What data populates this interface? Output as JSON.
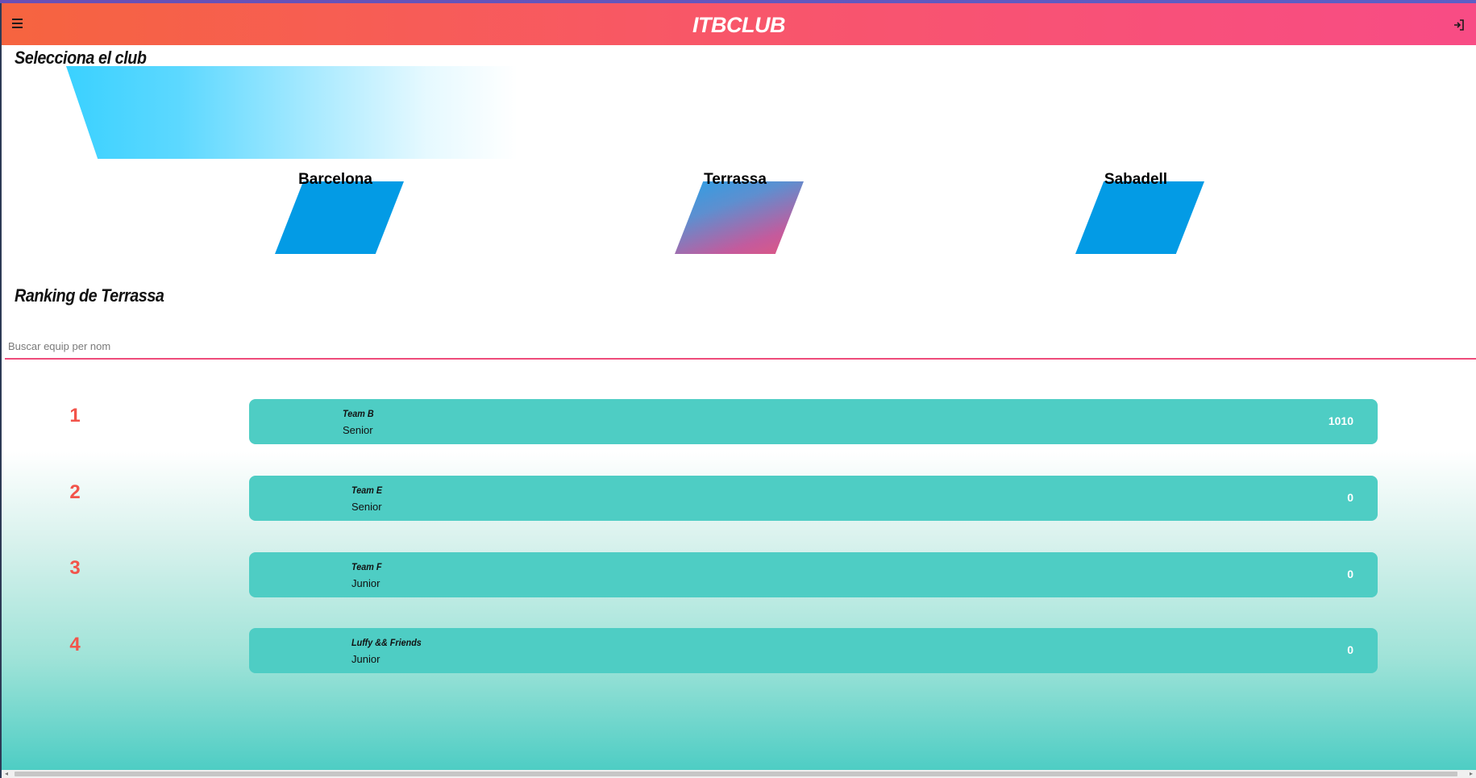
{
  "header": {
    "title": "ITBCLUB",
    "menu_icon": "hamburger-menu-icon",
    "login_icon": "sign-in-icon",
    "gradient_start": "#f6643f",
    "gradient_end": "#f84c85"
  },
  "select_section": {
    "title": "Selecciona el club"
  },
  "clubs": [
    {
      "name": "Barcelona",
      "active": false
    },
    {
      "name": "Terrassa",
      "active": true
    },
    {
      "name": "Sabadell",
      "active": false
    }
  ],
  "ranking": {
    "title": "Ranking de Terrassa",
    "search_placeholder": "Buscar equip per nom",
    "search_value": "",
    "accent_color": "#ee4b7a",
    "rank_color": "#f2544b",
    "card_color": "#4ecdc4",
    "teams": [
      {
        "rank": "1",
        "name": "Team B",
        "category": "Senior",
        "score": "1010"
      },
      {
        "rank": "2",
        "name": "Team E",
        "category": "Senior",
        "score": "0"
      },
      {
        "rank": "3",
        "name": "Team F",
        "category": "Junior",
        "score": "0"
      },
      {
        "rank": "4",
        "name": "Luffy && Friends",
        "category": "Junior",
        "score": "0"
      }
    ]
  }
}
